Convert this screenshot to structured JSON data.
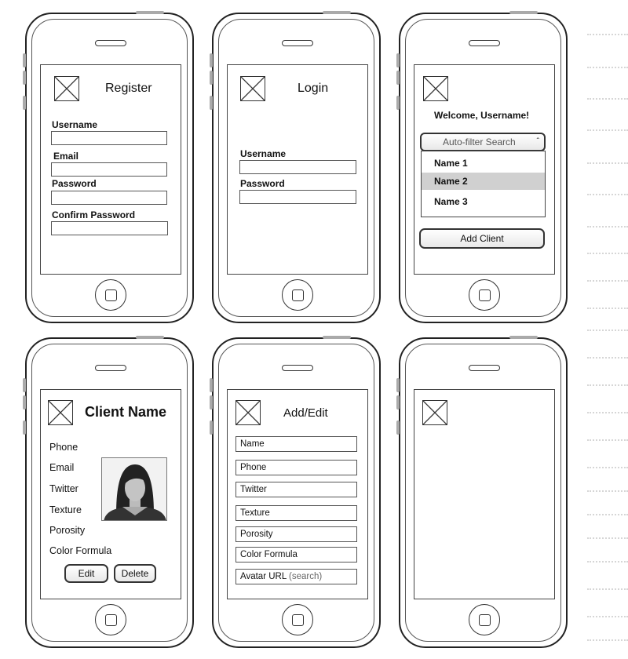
{
  "register": {
    "title": "Register",
    "fields": [
      {
        "label": "Username",
        "value": ""
      },
      {
        "label": "Email",
        "value": ""
      },
      {
        "label": "Password",
        "value": ""
      },
      {
        "label": "Confirm Password",
        "value": ""
      }
    ]
  },
  "login": {
    "title": "Login",
    "fields": [
      {
        "label": "Username",
        "value": ""
      },
      {
        "label": "Password",
        "value": ""
      }
    ]
  },
  "clients": {
    "welcome": "Welcome, Username!",
    "search_placeholder": "Auto-filter Search",
    "items": [
      "Name 1",
      "Name 2",
      "Name 3"
    ],
    "selected_index": 1,
    "add_button": "Add Client"
  },
  "client_detail": {
    "title": "Client Name",
    "labels": [
      "Phone",
      "Email",
      "Twitter",
      "Texture",
      "Porosity",
      "Color Formula"
    ],
    "edit_button": "Edit",
    "delete_button": "Delete"
  },
  "add_edit": {
    "title": "Add/Edit",
    "fields": [
      "Name",
      "Phone",
      "Twitter",
      "Texture",
      "Porosity",
      "Color Formula",
      "Avatar URL"
    ],
    "avatar_hint": "(search)"
  }
}
